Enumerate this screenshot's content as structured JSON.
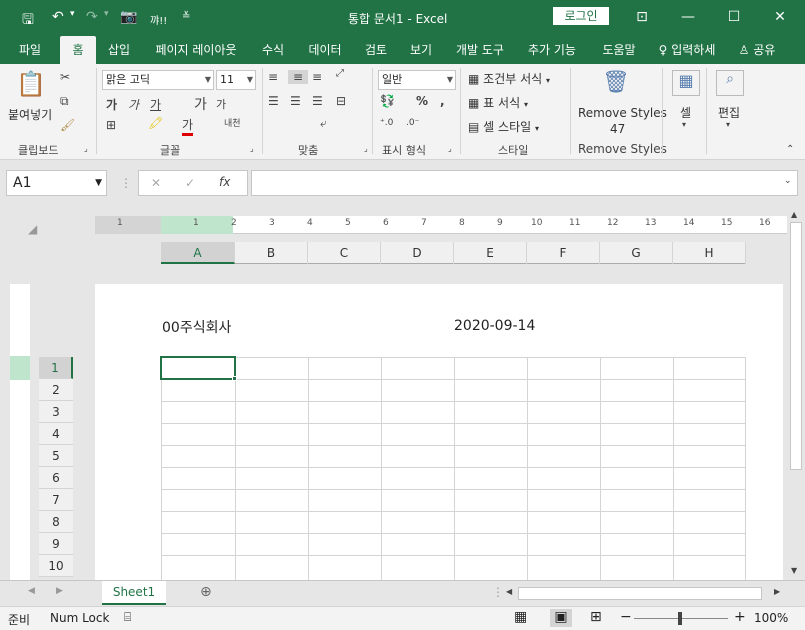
{
  "window": {
    "title": "통합 문서1 - Excel",
    "login_label": "로그인",
    "qa_custom": "꺄!!"
  },
  "tabs": [
    "파일",
    "홈",
    "삽입",
    "페이지 레이아웃",
    "수식",
    "데이터",
    "검토",
    "보기",
    "개발 도구",
    "추가 기능",
    "도움말",
    "입력하세",
    "공유"
  ],
  "ribbon": {
    "clipboard": {
      "paste": "붙여넣기",
      "group": "클립보드"
    },
    "font": {
      "name": "맑은 고딕",
      "size": "11",
      "group": "글꼴",
      "b1": "가",
      "b2": "가",
      "b3": "가",
      "grow": "가",
      "shrink": "가",
      "fontcolor": "가",
      "phonetic": "내천"
    },
    "align": {
      "group": "맞춤"
    },
    "number": {
      "format": "일반",
      "group": "표시 형식",
      "pct": "%",
      "comma": ","
    },
    "styles": {
      "cond": "조건부 서식",
      "table": "표 서식",
      "cell": "셀 스타일",
      "group": "스타일"
    },
    "remove": {
      "label": "Remove Styles",
      "count": "47",
      "group": "Remove Styles"
    },
    "cells": {
      "label": "셀"
    },
    "edit": {
      "label": "편집"
    }
  },
  "formula": {
    "namebox": "A1",
    "fx": "fx"
  },
  "ruler": [
    "1",
    "1",
    "2",
    "3",
    "4",
    "5",
    "6",
    "7",
    "8",
    "9",
    "10",
    "11",
    "12",
    "13",
    "14",
    "15",
    "16"
  ],
  "columns": [
    "A",
    "B",
    "C",
    "D",
    "E",
    "F",
    "G",
    "H"
  ],
  "rows": [
    "1",
    "2",
    "3",
    "4",
    "5",
    "6",
    "7",
    "8",
    "9",
    "10"
  ],
  "page_header": {
    "left": "00주식회사",
    "right": "2020-09-14"
  },
  "sheet": {
    "tab": "Sheet1"
  },
  "status": {
    "ready": "준비",
    "numlock": "Num Lock",
    "zoom": "100%"
  },
  "colors": {
    "accent": "#217346"
  }
}
